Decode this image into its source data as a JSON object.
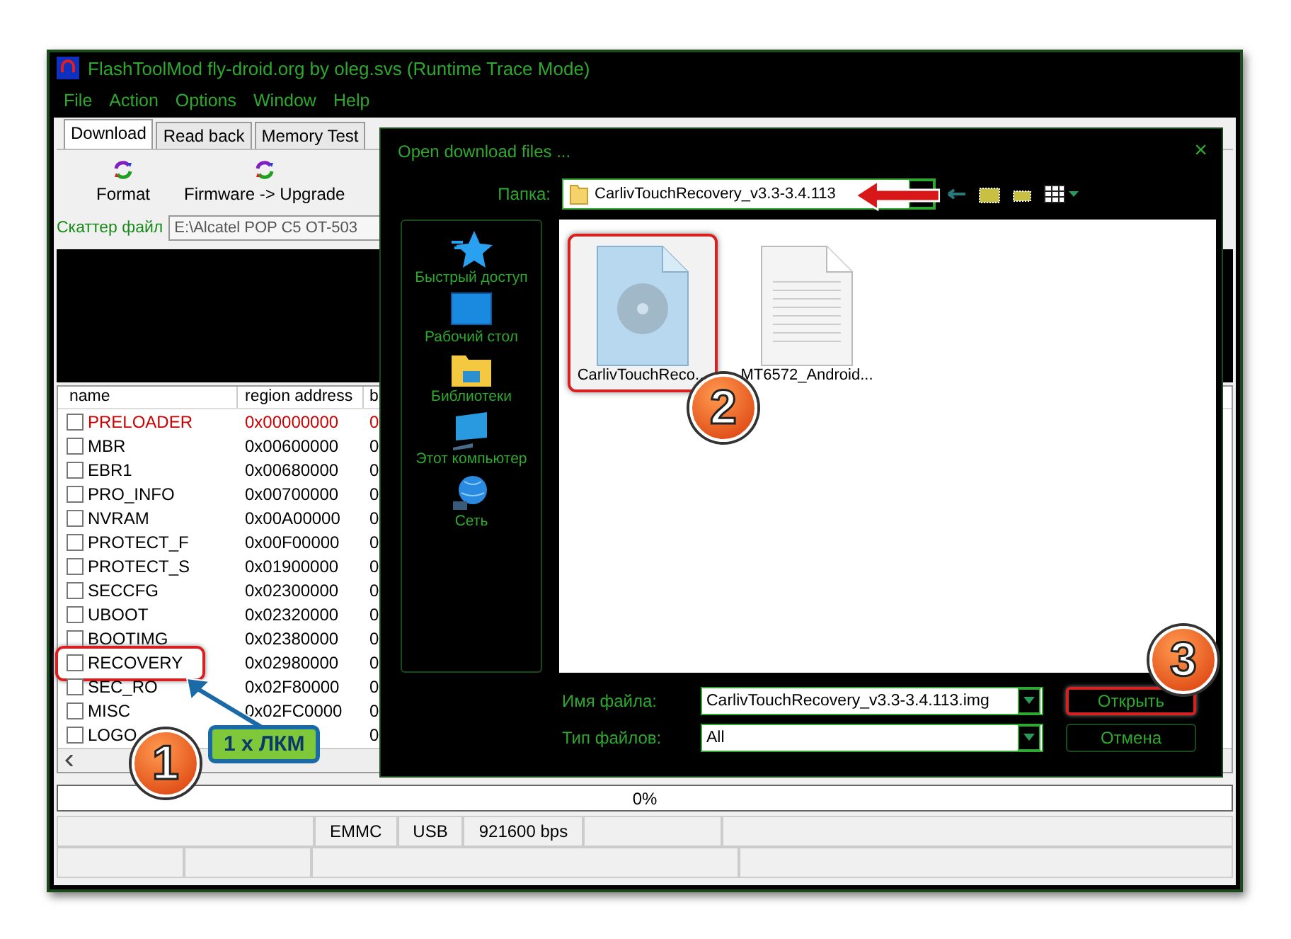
{
  "window": {
    "title": "FlashToolMod fly-droid.org by oleg.svs (Runtime Trace Mode)"
  },
  "menu": [
    "File",
    "Action",
    "Options",
    "Window",
    "Help"
  ],
  "tabs": [
    {
      "label": "Download",
      "selected": true
    },
    {
      "label": "Read back",
      "selected": false
    },
    {
      "label": "Memory Test",
      "selected": false
    }
  ],
  "toolbar": [
    {
      "label": "Format"
    },
    {
      "label": "Firmware -> Upgrade"
    }
  ],
  "scatter": {
    "label": "Скаттер файл",
    "value": "E:\\Alcatel POP C5 OT-503"
  },
  "partitions": {
    "columns": [
      "name",
      "region address",
      "b"
    ],
    "rows": [
      {
        "name": "PRELOADER",
        "address": "0x00000000",
        "column_3": "0",
        "checked": false,
        "highlighted": false,
        "color": "#cc0000"
      },
      {
        "name": "MBR",
        "address": "0x00600000",
        "column_3": "0",
        "checked": false,
        "highlighted": false,
        "color": "#000000"
      },
      {
        "name": "EBR1",
        "address": "0x00680000",
        "column_3": "0",
        "checked": false,
        "highlighted": false,
        "color": "#000000"
      },
      {
        "name": "PRO_INFO",
        "address": "0x00700000",
        "column_3": "0",
        "checked": false,
        "highlighted": false,
        "color": "#000000"
      },
      {
        "name": "NVRAM",
        "address": "0x00A00000",
        "column_3": "0",
        "checked": false,
        "highlighted": false,
        "color": "#000000"
      },
      {
        "name": "PROTECT_F",
        "address": "0x00F00000",
        "column_3": "0",
        "checked": false,
        "highlighted": false,
        "color": "#000000"
      },
      {
        "name": "PROTECT_S",
        "address": "0x01900000",
        "column_3": "0",
        "checked": false,
        "highlighted": false,
        "color": "#000000"
      },
      {
        "name": "SECCFG",
        "address": "0x02300000",
        "column_3": "0",
        "checked": false,
        "highlighted": false,
        "color": "#000000"
      },
      {
        "name": "UBOOT",
        "address": "0x02320000",
        "column_3": "0",
        "checked": false,
        "highlighted": false,
        "color": "#000000"
      },
      {
        "name": "BOOTIMG",
        "address": "0x02380000",
        "column_3": "0",
        "checked": false,
        "highlighted": false,
        "color": "#000000"
      },
      {
        "name": "RECOVERY",
        "address": "0x02980000",
        "column_3": "0",
        "checked": false,
        "highlighted": true,
        "color": "#000000"
      },
      {
        "name": "SEC_RO",
        "address": "0x02F80000",
        "column_3": "0",
        "checked": false,
        "highlighted": false,
        "color": "#000000"
      },
      {
        "name": "MISC",
        "address": "0x02FC0000",
        "column_3": "0",
        "checked": false,
        "highlighted": false,
        "color": "#000000"
      },
      {
        "name": "LOGO",
        "column_3": "0",
        "checked": false,
        "highlighted": false,
        "color": "#000000"
      }
    ]
  },
  "progress": {
    "text": "0%",
    "level": 0
  },
  "status_bar": [
    "EMMC",
    "USB",
    "921600 bps"
  ],
  "dialog": {
    "title": "Open download files ...",
    "close": "×",
    "folder_label": "Папка:",
    "folder": "CarlivTouchRecovery_v3.3-3.4.113",
    "places": [
      {
        "label": "Быстрый доступ",
        "kind": "star"
      },
      {
        "label": "Рабочий стол",
        "kind": "desktop"
      },
      {
        "label": "Библиотеки",
        "kind": "library"
      },
      {
        "label": "Этот компьютер",
        "kind": "computer"
      },
      {
        "label": "Сеть",
        "kind": "network"
      }
    ],
    "files": [
      {
        "name": "CarlivTouchReco...",
        "kind": "disc-image",
        "highlighted": true
      },
      {
        "name": "MT6572_Android...",
        "kind": "text",
        "highlighted": false
      }
    ],
    "filename_label": "Имя файла:",
    "filename": "CarlivTouchRecovery_v3.3-3.4.113.img",
    "filetype_label": "Тип файлов:",
    "filetype": "All",
    "buttons": [
      {
        "label": "Открыть",
        "highlighted": true
      },
      {
        "label": "Отмена",
        "highlighted": false
      }
    ]
  },
  "annotations": [
    {
      "kind": "step",
      "number": "1"
    },
    {
      "kind": "step",
      "number": "2"
    },
    {
      "kind": "step",
      "number": "3"
    },
    {
      "kind": "label",
      "text": "1 x ЛКМ"
    }
  ]
}
